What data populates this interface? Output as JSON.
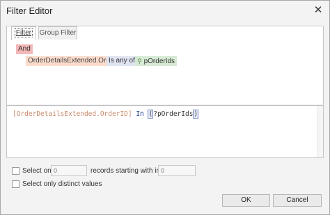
{
  "window": {
    "title": "Filter Editor",
    "close_glyph": "✕"
  },
  "tabs": [
    {
      "label": "Filter",
      "active": true
    },
    {
      "label": "Group Filter",
      "active": false
    }
  ],
  "tree": {
    "group_operator": "And",
    "condition": {
      "field": "OrderDetailsExtended.OrderID",
      "operator": "Is any of",
      "value": "pOrderIds",
      "value_icon": "parameter-icon"
    }
  },
  "expression": {
    "field": "[OrderDetailsExtended.OrderID]",
    "keyword": " In ",
    "open": "(",
    "param": "?pOrderIds",
    "close": ")"
  },
  "options": {
    "select_only_label": "Select only",
    "select_only_value": "0",
    "records_label": "records starting with index",
    "index_value": "0",
    "distinct_label": "Select only distinct values"
  },
  "buttons": {
    "ok": "OK",
    "cancel": "Cancel"
  },
  "colors": {
    "and_token": "#f4b8b8",
    "field_token": "#fbdccc",
    "operator_token": "#dfe4f0",
    "value_token": "#d6ead4"
  }
}
